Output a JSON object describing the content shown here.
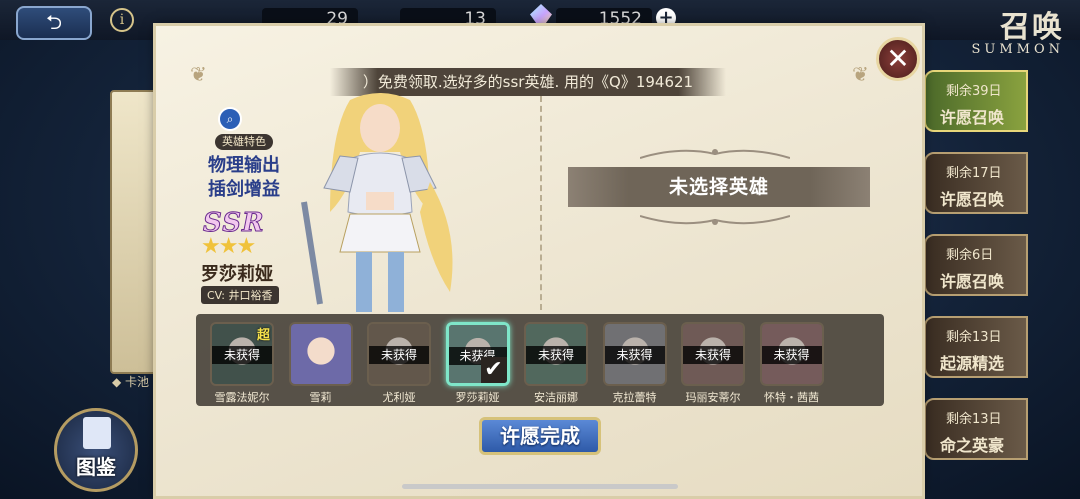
{
  "topbar": {
    "resources": [
      "29",
      "13",
      "1552"
    ],
    "summon_title": "召唤",
    "summon_subtitle": "SUMMON"
  },
  "right_tabs": [
    {
      "remaining": "剩余39日",
      "name": "许愿召唤",
      "active": true
    },
    {
      "remaining": "剩余17日",
      "name": "许愿召唤",
      "active": false
    },
    {
      "remaining": "剩余6日",
      "name": "许愿召唤",
      "active": false
    },
    {
      "remaining": "剩余13日",
      "name": "起源精选",
      "active": false
    },
    {
      "remaining": "剩余13日",
      "name": "命之英豪",
      "active": false
    }
  ],
  "left": {
    "bottom_label": "卡池",
    "codex_label": "图鉴"
  },
  "dialog": {
    "notice": "）免费领取.选好多的ssr英雄. 用的《Q》194621",
    "hero": {
      "trait_tag": "英雄特色",
      "trait_line1": "物理输出",
      "trait_line2": "插剑增益",
      "rarity": "SSR",
      "stars": "★★★",
      "name": "罗莎莉娅",
      "cv": "CV: 井口裕香"
    },
    "no_selection": "未选择英雄",
    "complete_button": "许愿完成",
    "slots": [
      {
        "name": "雪露法妮尔",
        "status": "未获得",
        "super": "超",
        "selected": false,
        "color": "#3f6b5a"
      },
      {
        "name": "雪莉",
        "status": "",
        "super": "",
        "selected": false,
        "color": "#6d6aa8"
      },
      {
        "name": "尤利娅",
        "status": "未获得",
        "super": "",
        "selected": false,
        "color": "#8a6a4a"
      },
      {
        "name": "罗莎莉娅",
        "status": "未获得",
        "super": "",
        "selected": true,
        "color": "#4f9c8a"
      },
      {
        "name": "安洁丽娜",
        "status": "未获得",
        "super": "",
        "selected": false,
        "color": "#4c8a6c"
      },
      {
        "name": "克拉蕾特",
        "status": "未获得",
        "super": "",
        "selected": false,
        "color": "#8b8b95"
      },
      {
        "name": "玛丽安蒂尔",
        "status": "未获得",
        "super": "",
        "selected": false,
        "color": "#a56a5e"
      },
      {
        "name": "怀特・茜茜",
        "status": "未获得",
        "super": "",
        "selected": false,
        "color": "#b06a6a"
      }
    ]
  }
}
